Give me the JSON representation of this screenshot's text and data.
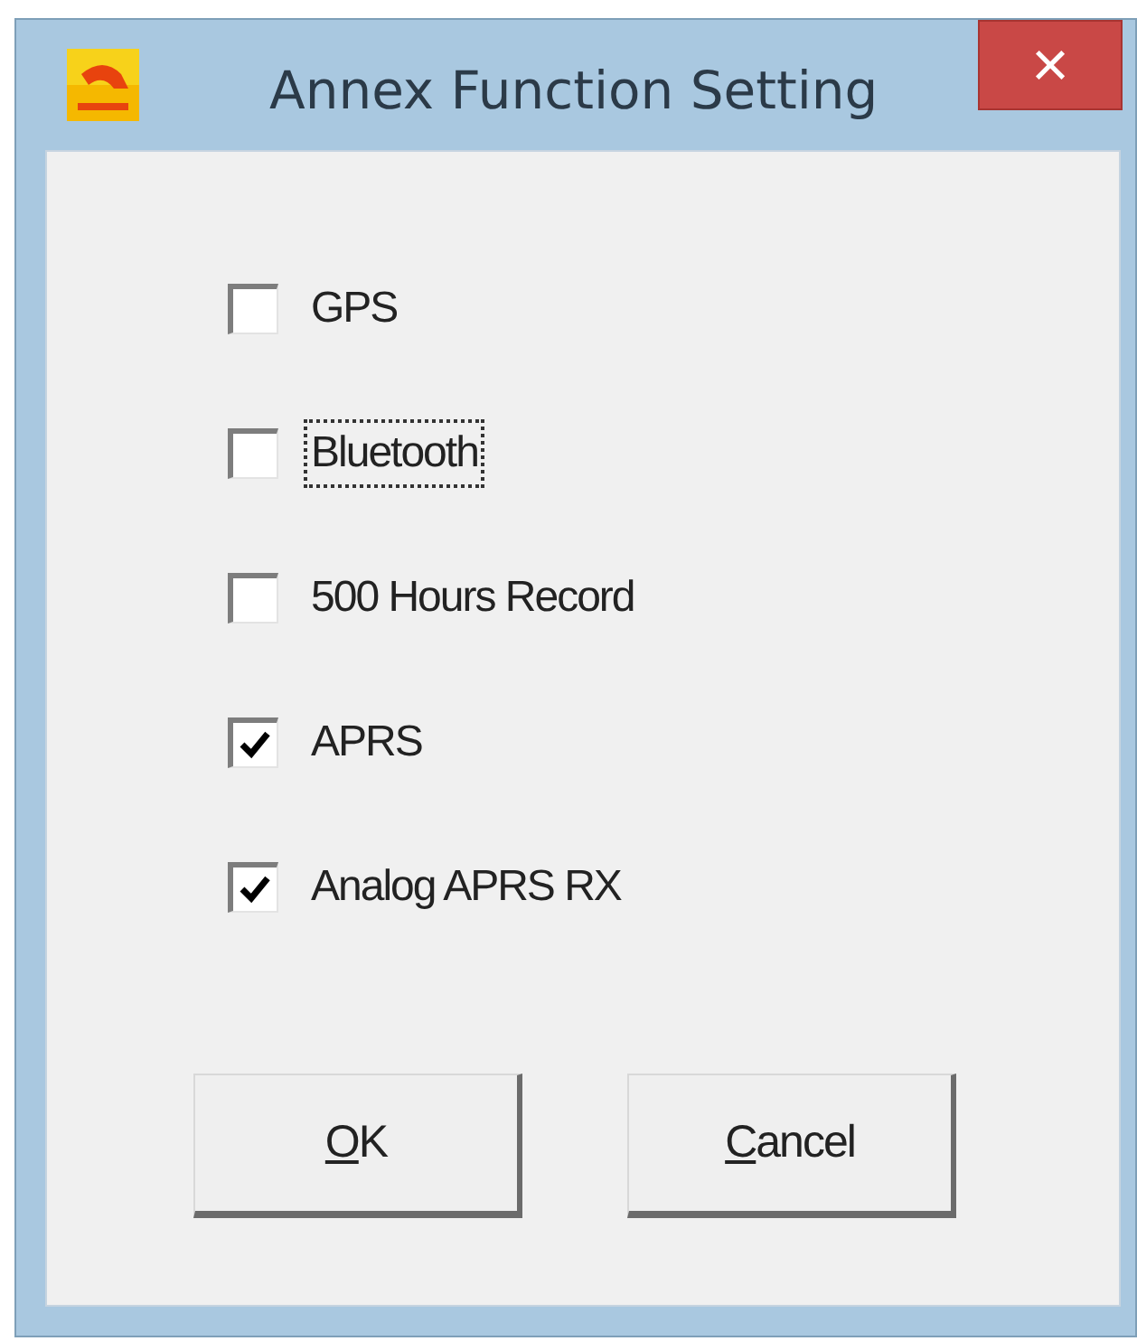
{
  "window": {
    "title": "Annex Function Setting",
    "close_label": "×"
  },
  "options": [
    {
      "label": "GPS",
      "checked": false,
      "focused": false
    },
    {
      "label": "Bluetooth",
      "checked": false,
      "focused": true
    },
    {
      "label": "500 Hours Record",
      "checked": false,
      "focused": false
    },
    {
      "label": "APRS",
      "checked": true,
      "focused": false
    },
    {
      "label": "Analog APRS RX",
      "checked": true,
      "focused": false
    }
  ],
  "buttons": [
    {
      "label": "OK",
      "mnemonic_underlined": true
    },
    {
      "label": "Cancel",
      "mnemonic_underlined": true
    }
  ]
}
